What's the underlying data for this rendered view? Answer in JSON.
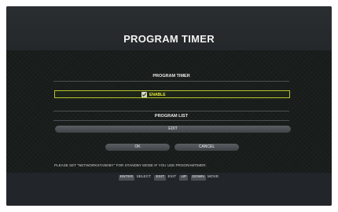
{
  "header": {
    "title": "PROGRAM TIMER"
  },
  "timer_section": {
    "title": "PROGRAM TIMER",
    "enable_label": "ENABLE",
    "enable_checked": true
  },
  "list_section": {
    "title": "PROGRAM LIST",
    "edit_label": "EDIT"
  },
  "actions": {
    "ok_label": "OK",
    "cancel_label": "CANCEL"
  },
  "note": "PLEASE SET \"NETWORKSTANDBY\" FOR STANDBY MODE IF YOU USE PROGRAMTIMER.",
  "legend": {
    "enter_key": "ENTER",
    "select_label": "SELECT",
    "exit_key": "EXIT",
    "exit_label": "EXIT",
    "up_key": "UP",
    "down_key": "DOWN",
    "move_label": "MOVE"
  },
  "colors": {
    "accent": "#b7c22a",
    "enable_text": "#e7ec3a",
    "background": "#171c1a"
  }
}
